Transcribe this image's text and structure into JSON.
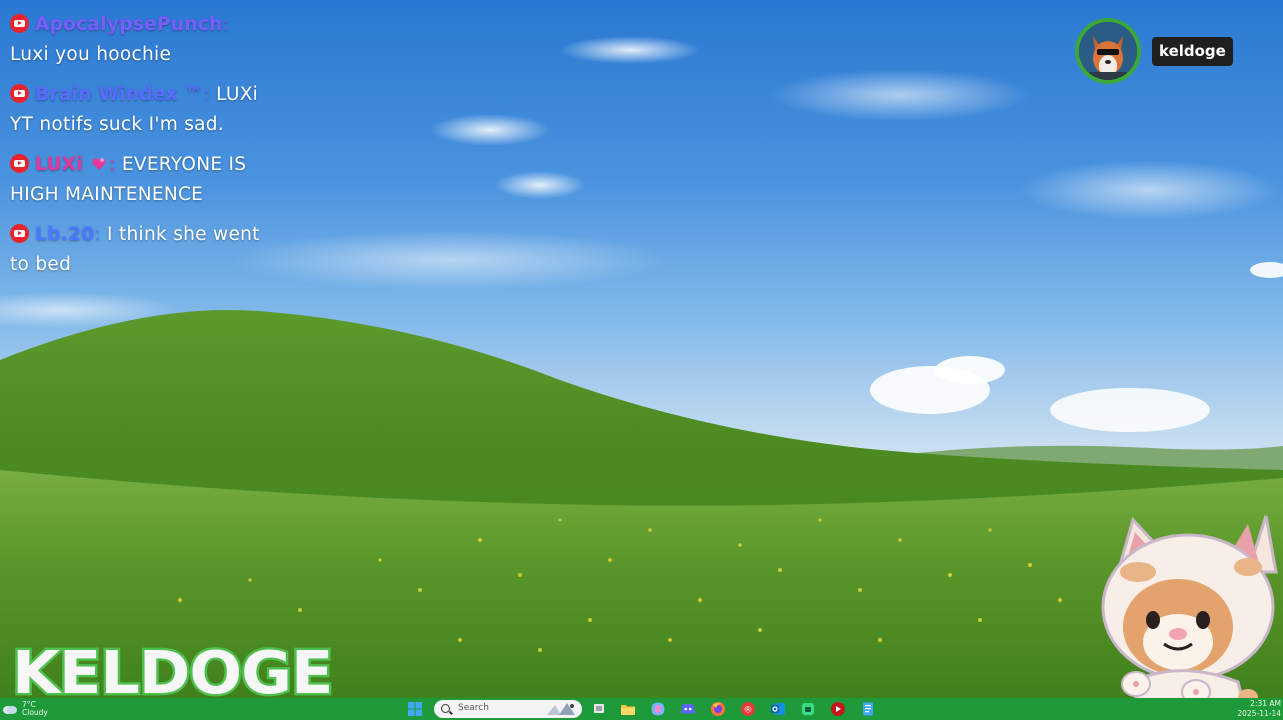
{
  "chat": {
    "messages": [
      {
        "user": "ApocalypsePunch",
        "text": "Luxi you hoochie",
        "color": "#7b5cff",
        "icon": "youtube-icon"
      },
      {
        "user": "Brain Windex ™",
        "text": "LUXi YT notifs suck I'm sad.",
        "color": "#5a6bff",
        "icon": "youtube-icon"
      },
      {
        "user": "LUXi",
        "text": "EVERYONE IS HIGH MAINTENENCE",
        "color": "#e6379a",
        "icon": "youtube-icon",
        "badge": "heart-icon"
      },
      {
        "user": "Lb.20",
        "text": "I think she went to bed",
        "color": "#4a77ff",
        "icon": "youtube-icon"
      }
    ]
  },
  "streamer": {
    "name": "keldoge",
    "logo_text": "KELDOGE",
    "ring_color": "#3aa83a"
  },
  "taskbar": {
    "color": "#1f9a3a",
    "weather": {
      "temp": "7°C",
      "condition": "Cloudy",
      "icon": "cloud-icon"
    },
    "search": {
      "placeholder": "Search"
    },
    "apps": [
      "windows-start-icon",
      "task-view-icon",
      "file-explorer-icon",
      "copilot-icon",
      "discord-icon",
      "firefox-icon",
      "app-red-icon",
      "outlook-icon",
      "android-icon",
      "youtube-music-icon",
      "notepad-icon"
    ],
    "clock": {
      "time": "2:31 AM",
      "date": "2025-11-14"
    }
  }
}
